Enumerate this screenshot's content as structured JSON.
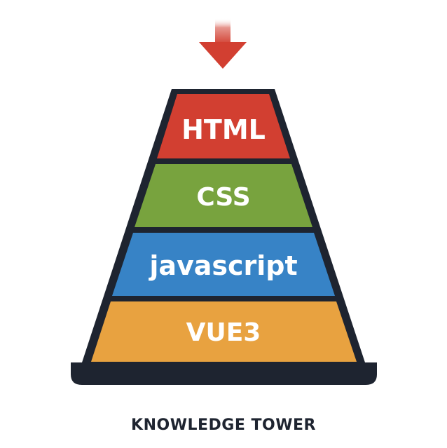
{
  "diagram": {
    "tiers": [
      {
        "label": "HTML",
        "color": "#d23f31"
      },
      {
        "label": "CSS",
        "color": "#78a33e"
      },
      {
        "label": "javascript",
        "color": "#3783c6"
      },
      {
        "label": "VUE3",
        "color": "#e8a240"
      }
    ],
    "arrow_color": "#d23f31",
    "outline_color": "#1e2430",
    "caption": "KNOWLEDGE TOWER"
  }
}
